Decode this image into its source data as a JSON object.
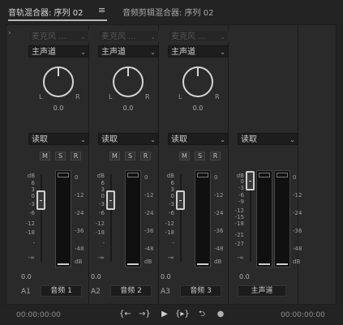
{
  "tabs": [
    {
      "label": "音轨混合器: 序列 02",
      "active": true
    },
    {
      "label": "音频剪辑混合器: 序列 02",
      "active": false
    }
  ],
  "menu_icon": "hamburger-menu-icon",
  "channels": [
    {
      "id": "A1",
      "name": "音频 1",
      "input": "麦克风 ...",
      "output": "主声道",
      "automation": "读取",
      "pan": "0.0",
      "volume": "0.0",
      "buttons": [
        "M",
        "S",
        "R"
      ]
    },
    {
      "id": "A2",
      "name": "音频 2",
      "input": "麦克风 ...",
      "output": "主声道",
      "automation": "读取",
      "pan": "0.0",
      "volume": "0.0",
      "buttons": [
        "M",
        "S",
        "R"
      ]
    },
    {
      "id": "A3",
      "name": "音频 3",
      "input": "麦克风 ...",
      "output": "主声道",
      "automation": "读取",
      "pan": "0.0",
      "volume": "0.0",
      "buttons": [
        "M",
        "S",
        "R"
      ]
    },
    {
      "id": "",
      "name": "主声道",
      "automation": "读取",
      "volume": "0.0"
    }
  ],
  "pan_labels": {
    "left": "L",
    "right": "R"
  },
  "fader_scale": [
    "dB",
    "6",
    "3",
    "0",
    "-3",
    "-6",
    "-12",
    "-18",
    "-",
    "-∞"
  ],
  "master_fader_scale": [
    "dB",
    "0",
    "-3",
    "-6",
    "-9",
    "-12",
    "-15",
    "-18",
    "-21",
    "-27",
    "-∞"
  ],
  "meter_scale": [
    "0",
    "-12",
    "-24",
    "-36",
    "-48",
    "dB"
  ],
  "footer": {
    "timecode_left": "00:00:00:00",
    "timecode_right": "00:00:00:00",
    "transport": [
      {
        "name": "go-to-in-point-icon",
        "glyph": "{←"
      },
      {
        "name": "go-to-out-point-icon",
        "glyph": "→}"
      },
      {
        "name": "play-icon",
        "glyph": "▶"
      },
      {
        "name": "play-in-to-out-icon",
        "glyph": "{▸}"
      },
      {
        "name": "loop-icon",
        "glyph": "⮌"
      },
      {
        "name": "record-icon",
        "glyph": "●"
      }
    ]
  }
}
